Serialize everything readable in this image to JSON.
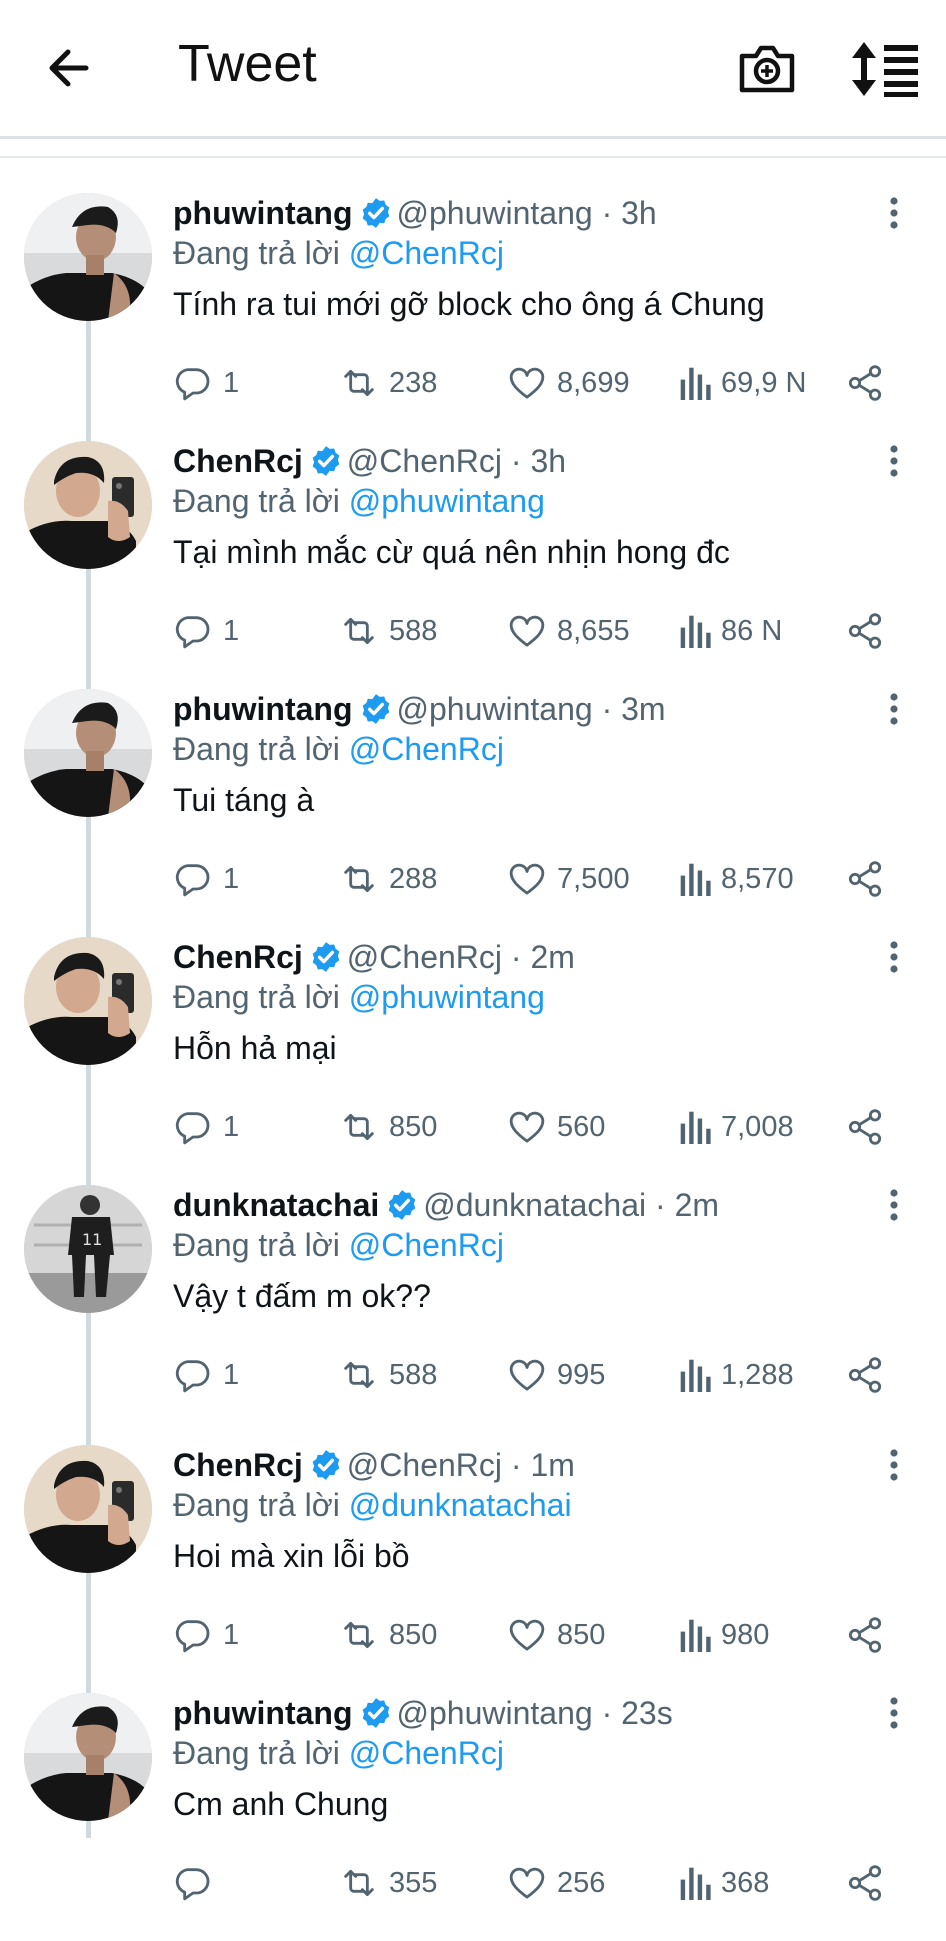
{
  "header": {
    "title": "Tweet"
  },
  "reply_prefix": "Đang trả lời",
  "tweets": [
    {
      "name": "phuwintang",
      "handle": "@phuwintang · 3h",
      "reply_to": "@ChenRcj",
      "text": "Tính ra tui mới gỡ block cho ông á Chung",
      "replies": "1",
      "retweets": "238",
      "likes": "8,699",
      "views": "69,9 N",
      "avatar": "phuwin-avatar"
    },
    {
      "name": "ChenRcj",
      "handle": "@ChenRcj · 3h",
      "reply_to": "@phuwintang",
      "text": "Tại mình mắc cừ quá nên nhịn hong đc",
      "replies": "1",
      "retweets": "588",
      "likes": "8,655",
      "views": "86 N",
      "avatar": "chen-avatar"
    },
    {
      "name": "phuwintang",
      "handle": "@phuwintang · 3m",
      "reply_to": "@ChenRcj",
      "text": "Tui táng à",
      "replies": "1",
      "retweets": "288",
      "likes": "7,500",
      "views": "8,570",
      "avatar": "phuwin-avatar"
    },
    {
      "name": "ChenRcj",
      "handle": "@ChenRcj · 2m",
      "reply_to": "@phuwintang",
      "text": "Hỗn hả mại",
      "replies": "1",
      "retweets": "850",
      "likes": "560",
      "views": "7,008",
      "avatar": "chen-avatar"
    },
    {
      "name": "dunknatachai",
      "handle": "@dunknatachai · 2m",
      "reply_to": "@ChenRcj",
      "text": "Vậy t đấm m ok??",
      "replies": "1",
      "retweets": "588",
      "likes": "995",
      "views": "1,288",
      "avatar": "dunk-avatar"
    },
    {
      "name": "ChenRcj",
      "handle": "@ChenRcj · 1m",
      "reply_to": "@dunknatachai",
      "text": "Hoi mà xin lỗi bồ",
      "replies": "1",
      "retweets": "850",
      "likes": "850",
      "views": "980",
      "avatar": "chen-avatar"
    },
    {
      "name": "phuwintang",
      "handle": "@phuwintang · 23s",
      "reply_to": "@ChenRcj",
      "text": "Cm anh Chung",
      "replies": "",
      "retweets": "355",
      "likes": "256",
      "views": "368",
      "avatar": "phuwin-avatar"
    }
  ],
  "colors": {
    "accent": "#1d9bf0",
    "muted": "#536471",
    "thread_line": "#cfd9de"
  }
}
